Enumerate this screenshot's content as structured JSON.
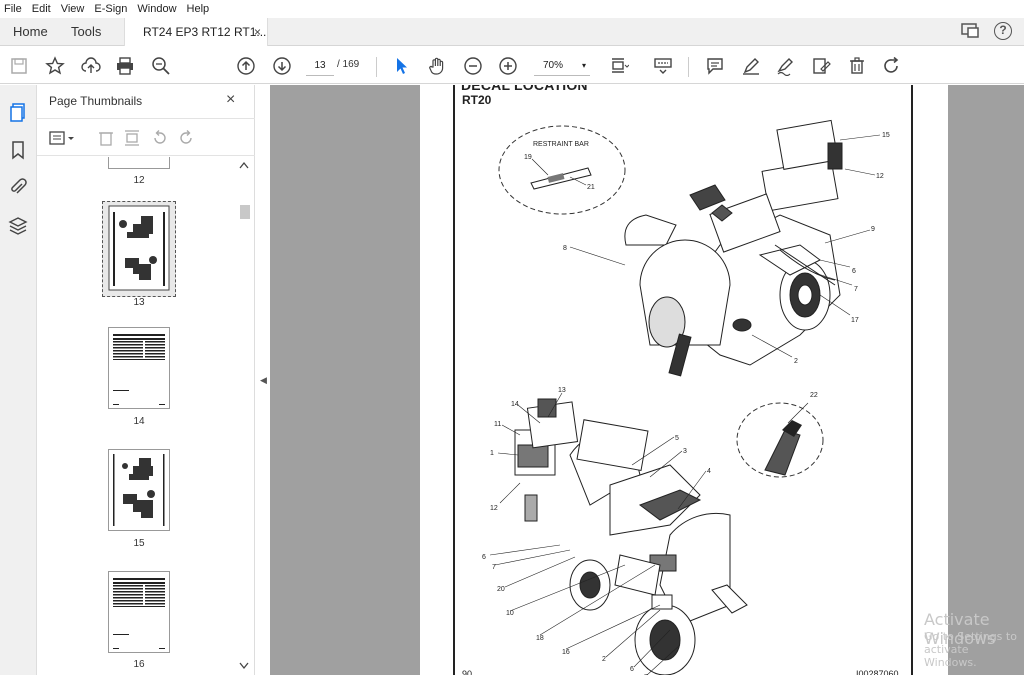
{
  "menu": [
    "File",
    "Edit",
    "View",
    "E-Sign",
    "Window",
    "Help"
  ],
  "tabs": {
    "home": "Home",
    "tools": "Tools",
    "document": "RT24 EP3 RT12 RT1...",
    "close": "×"
  },
  "toolbar": {
    "current_page": "13",
    "page_total": "/ 169",
    "zoom": "70%",
    "zoom_caret": "▾"
  },
  "thumbnails": {
    "title": "Page Thumbnails",
    "close": "×",
    "pages": [
      {
        "label": "12"
      },
      {
        "label": "13"
      },
      {
        "label": "14"
      },
      {
        "label": "15"
      },
      {
        "label": "16"
      }
    ]
  },
  "document": {
    "title": "DECAL LOCATION",
    "subtitle": "RT20",
    "page_number": "90",
    "doc_id": "I00287060",
    "restraint_label": "RESTRAINT BAR",
    "top_callouts": [
      "15",
      "12",
      "9",
      "6",
      "7",
      "17",
      "2",
      "8",
      "19",
      "21"
    ],
    "bottom_callouts": [
      "13",
      "14",
      "11",
      "1",
      "12",
      "5",
      "3",
      "4",
      "6",
      "7",
      "20",
      "10",
      "18",
      "16",
      "2",
      "6",
      "7",
      "22"
    ]
  },
  "watermark": {
    "line1": "Activate Windows",
    "line2": "Go to Settings to activate Windows."
  },
  "colors": {
    "accent": "#1473e6",
    "viewer_bg": "#a0a0a0",
    "chrome_bg": "#f0f0f0"
  }
}
